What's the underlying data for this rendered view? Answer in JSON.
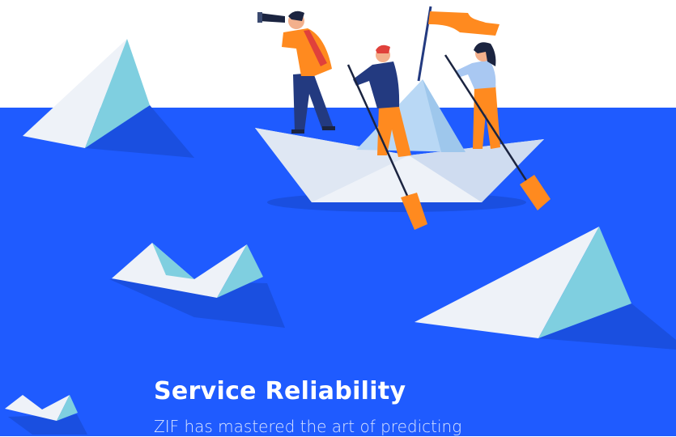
{
  "colors": {
    "sky": "#ffffff",
    "ocean": "#1f5bff",
    "paper_light": "#eef2f8",
    "paper_cyan": "#7fcfe0",
    "paper_shadow": "#1a4fe0",
    "accent_orange": "#ff8a1f",
    "navy": "#233a80"
  },
  "illustration": {
    "icons": [
      "paper-boat-icon",
      "paper-iceberg-icon",
      "telescope-icon",
      "oar-icon",
      "flag-icon"
    ]
  },
  "feature": {
    "title": "Service Reliability",
    "description": "ZIF has mastered the art of predicting"
  }
}
